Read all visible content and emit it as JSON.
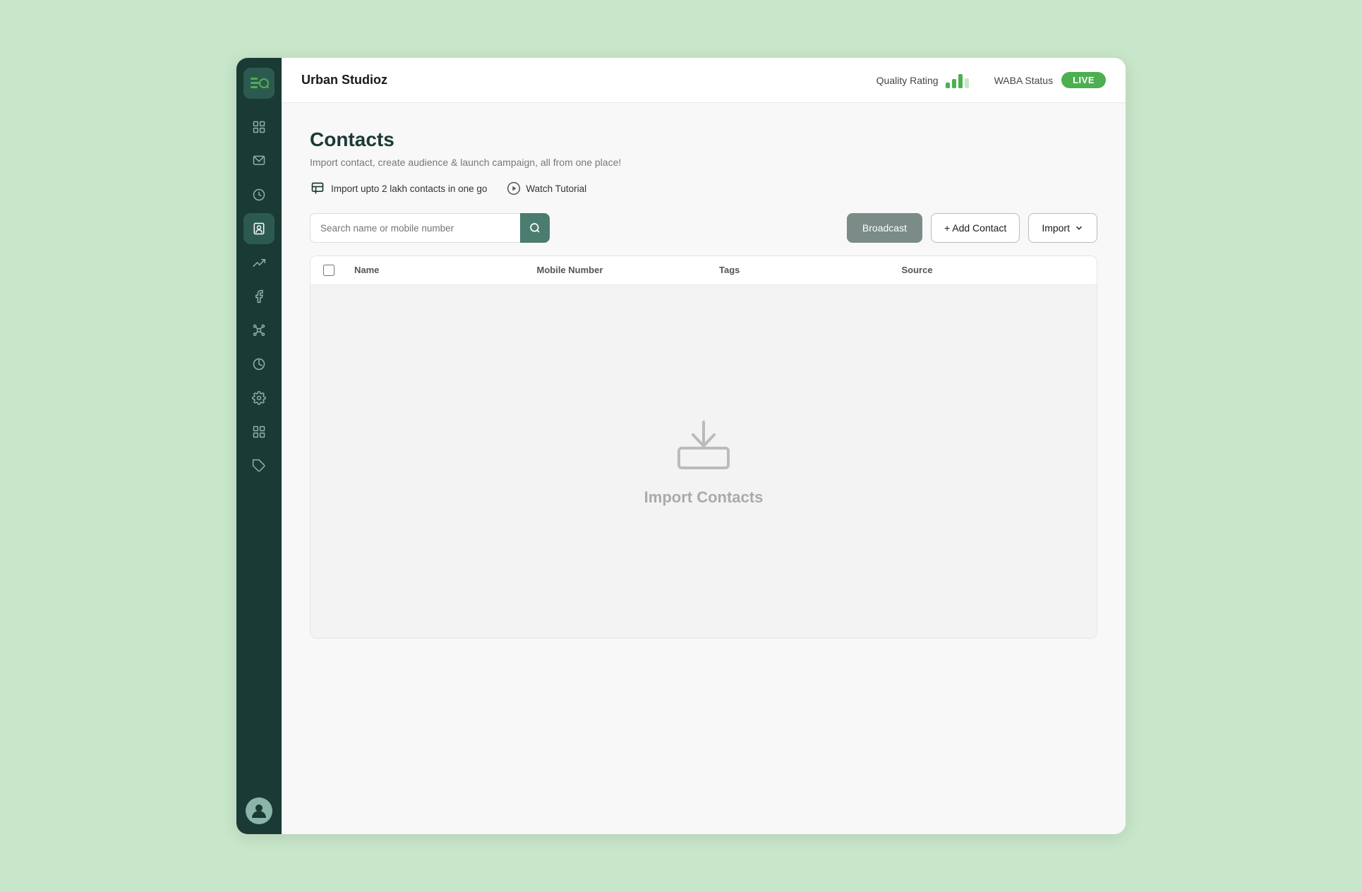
{
  "sidebar": {
    "logo_alt": "Urban Studioz Logo",
    "items": [
      {
        "id": "dashboard",
        "label": "Dashboard",
        "active": false
      },
      {
        "id": "messages",
        "label": "Messages",
        "active": false
      },
      {
        "id": "history",
        "label": "History",
        "active": false
      },
      {
        "id": "contacts",
        "label": "Contacts",
        "active": true
      },
      {
        "id": "campaigns",
        "label": "Campaigns",
        "active": false
      },
      {
        "id": "facebook",
        "label": "Facebook",
        "active": false
      },
      {
        "id": "integrations",
        "label": "Integrations",
        "active": false
      },
      {
        "id": "analytics",
        "label": "Analytics",
        "active": false
      },
      {
        "id": "settings",
        "label": "Settings",
        "active": false
      },
      {
        "id": "extensions",
        "label": "Extensions",
        "active": false
      },
      {
        "id": "tags",
        "label": "Tags",
        "active": false
      }
    ]
  },
  "header": {
    "app_name": "Urban Studioz",
    "quality_rating_label": "Quality Rating",
    "waba_status_label": "WABA Status",
    "live_badge": "LIVE"
  },
  "page": {
    "title": "Contacts",
    "subtitle": "Import contact, create audience & launch campaign, all from one place!",
    "promo_text": "Import upto 2 lakh contacts in one go",
    "watch_tutorial": "Watch Tutorial"
  },
  "toolbar": {
    "search_placeholder": "Search name or mobile number",
    "broadcast_label": "Broadcast",
    "add_contact_label": "+ Add Contact",
    "import_label": "Import"
  },
  "table": {
    "columns": [
      "Name",
      "Mobile Number",
      "Tags",
      "Source"
    ],
    "empty_label": "Import Contacts"
  }
}
